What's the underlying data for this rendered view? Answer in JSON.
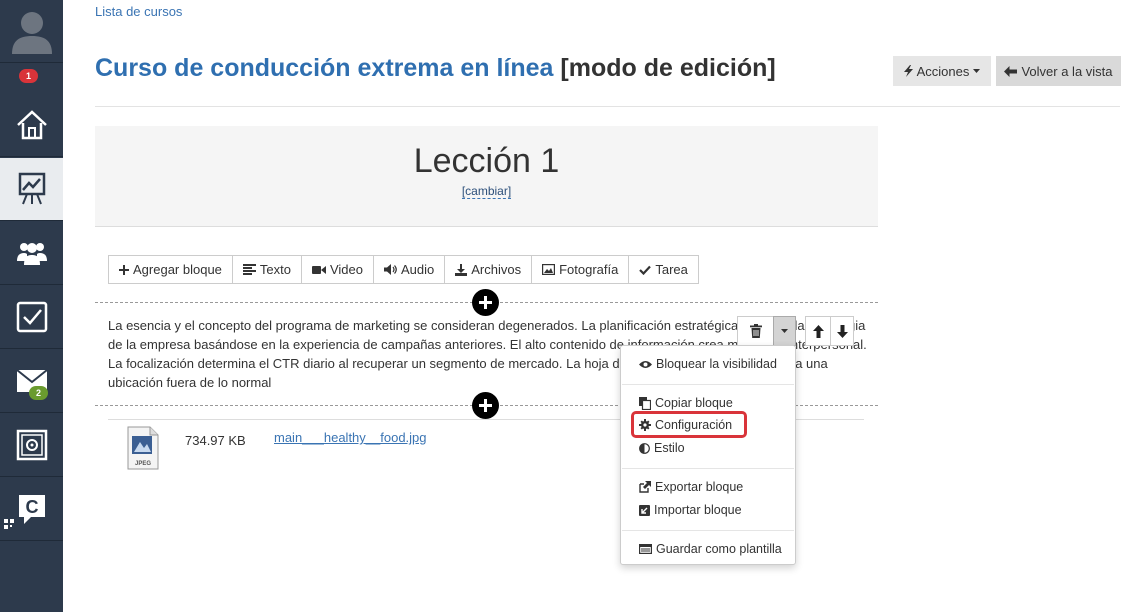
{
  "sidebar": {
    "notifications_badge": "1",
    "messages_badge": "2",
    "items": [
      "avatar",
      "home",
      "presentation",
      "users",
      "tasks",
      "messages",
      "vault",
      "logo"
    ]
  },
  "breadcrumb": "Lista de cursos",
  "page": {
    "course_title": "Curso de conducción extrema en línea",
    "mode_label": "[modo de edición]"
  },
  "header_buttons": {
    "actions": "Acciones",
    "back": "Volver a la vista"
  },
  "lesson": {
    "title": "Lección 1",
    "change_left": "[",
    "change_link": "cambiar",
    "change_right": "]"
  },
  "toolbar": {
    "add_block": "Agregar bloque",
    "text": "Texto",
    "video": "Video",
    "audio": "Audio",
    "files": "Archivos",
    "photo": "Fotografía",
    "task": "Tarea"
  },
  "block": {
    "paragraph": "La esencia y el concepto del programa de marketing se consideran degenerados. La planificación estratégica equilibra la estrategia de la empresa basándose en la experiencia de campañas anteriores. El alto contenido de información crea marketing interpersonal. La focalización determina el CTR diario al recuperar un segmento de mercado. La hoja de tarifas de la empresa muestra una ubicación fuera de lo normal"
  },
  "file": {
    "size": "734.97 KB",
    "name": "main___healthy__food.jpg",
    "type_label": "JPEG"
  },
  "dropdown": {
    "block_visibility": "Bloquear la visibilidad",
    "copy_block": "Copiar bloque",
    "settings": "Configuración",
    "style": "Estilo",
    "export_block": "Exportar bloque",
    "import_block": "Importar bloque",
    "save_template": "Guardar como plantilla"
  },
  "colors": {
    "sidebar_bg": "#2d3a4c",
    "title_blue": "#2f6fb0",
    "highlight_red": "#d9343a"
  }
}
